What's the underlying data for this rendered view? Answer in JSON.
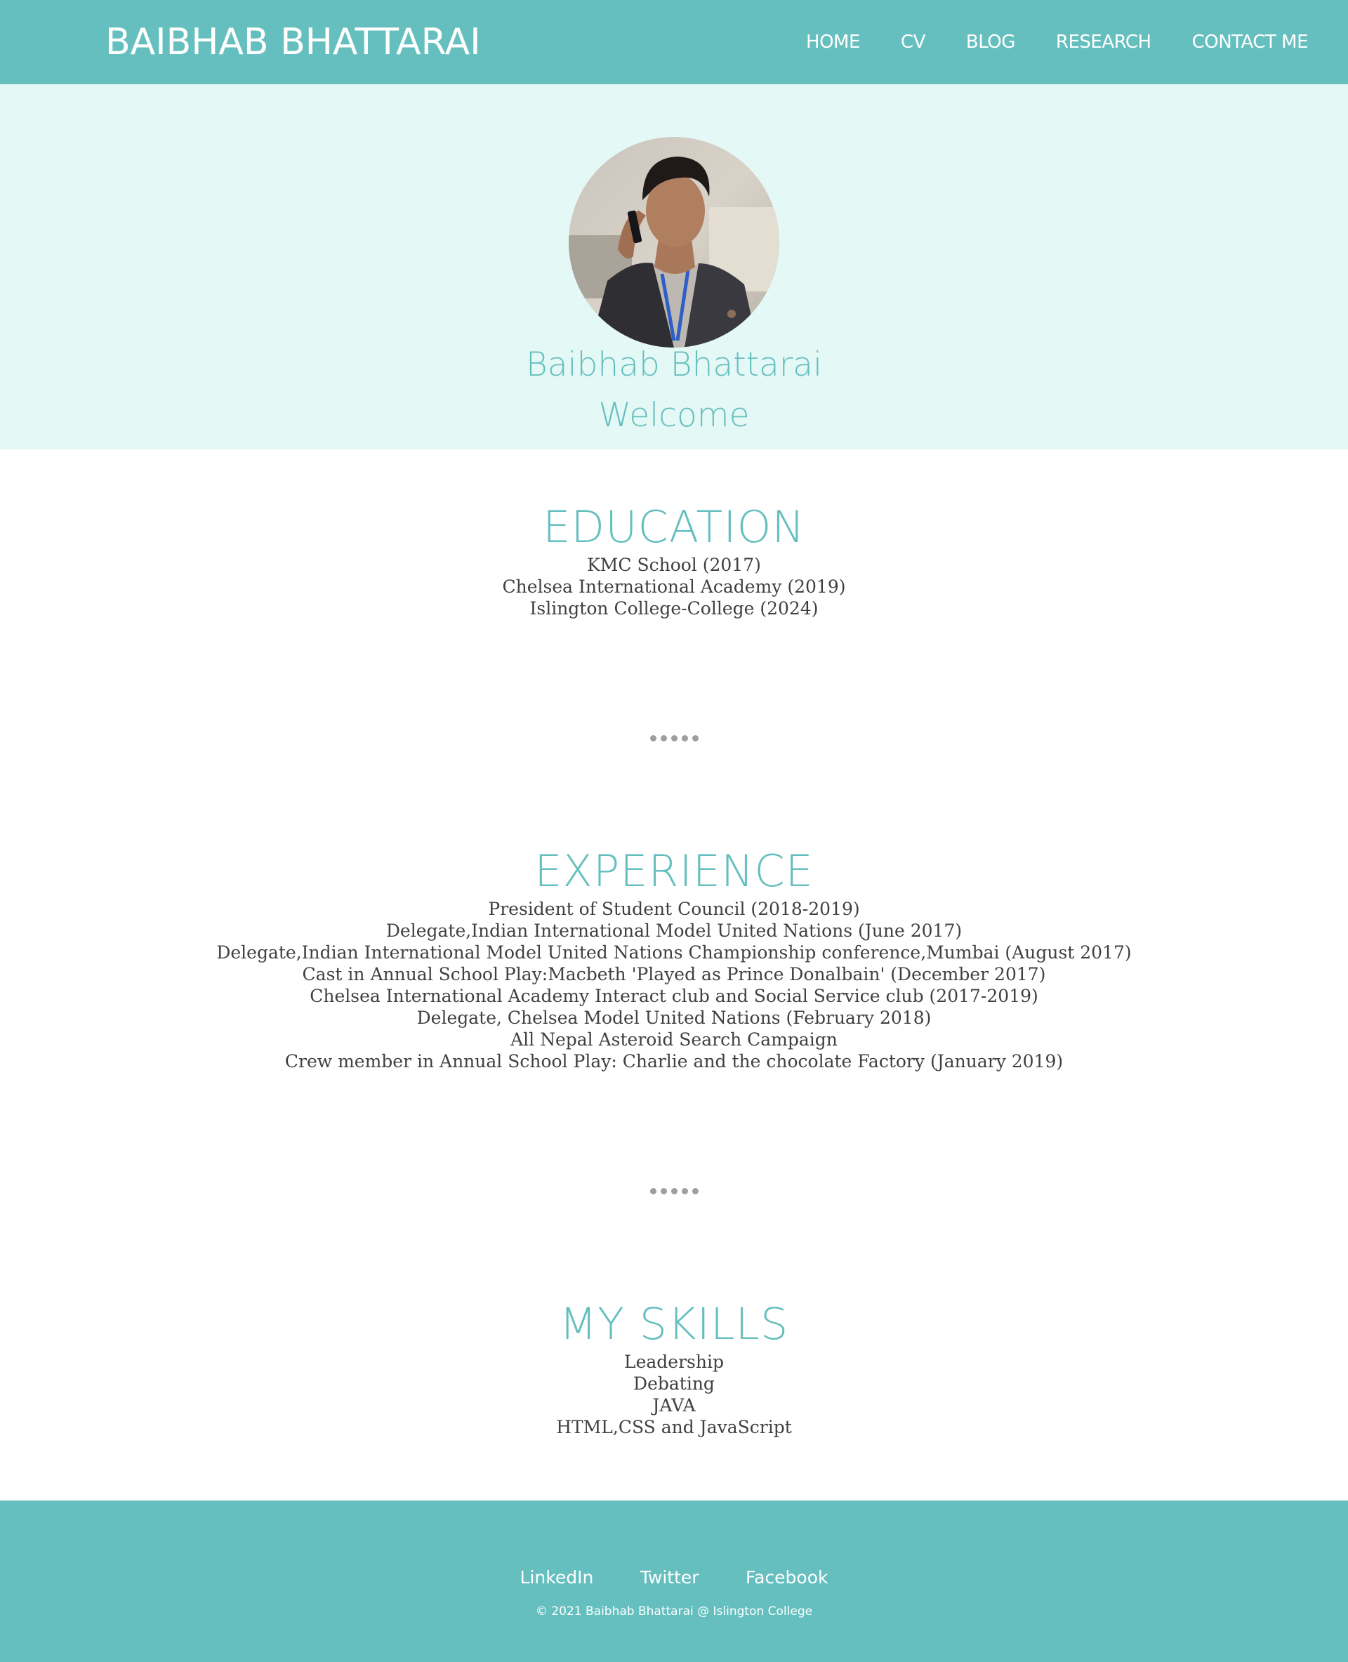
{
  "header": {
    "brand": "BAIBHAB BHATTARAI",
    "nav": [
      {
        "label": "HOME"
      },
      {
        "label": "CV"
      },
      {
        "label": "BLOG"
      },
      {
        "label": "RESEARCH"
      },
      {
        "label": "CONTACT ME"
      }
    ]
  },
  "hero": {
    "name": "Baibhab Bhattarai",
    "welcome": "Welcome"
  },
  "education": {
    "title": "EDUCATION",
    "items": [
      "KMC School (2017)",
      "Chelsea International Academy (2019)",
      "Islington College-College (2024)"
    ]
  },
  "experience": {
    "title": "EXPERIENCE",
    "items": [
      "President of Student Council (2018-2019)",
      "Delegate,Indian International Model United Nations (June 2017)",
      "Delegate,Indian International Model United Nations Championship conference,Mumbai (August 2017)",
      "Cast in Annual School Play:Macbeth 'Played as Prince Donalbain' (December 2017)",
      "Chelsea International Academy Interact club and Social Service club (2017-2019)",
      "Delegate, Chelsea Model United Nations (February 2018)",
      "All Nepal Asteroid Search Campaign",
      "Crew member in Annual School Play: Charlie and the chocolate Factory (January 2019)"
    ]
  },
  "skills": {
    "title": "MY SKILLS",
    "items": [
      "Leadership",
      "Debating",
      "JAVA",
      "HTML,CSS and JavaScript"
    ]
  },
  "footer": {
    "links": [
      {
        "label": "LinkedIn"
      },
      {
        "label": "Twitter"
      },
      {
        "label": "Facebook"
      }
    ],
    "copyright": "© 2021 Baibhab Bhattarai @ Islington College"
  },
  "colors": {
    "accent": "#66bfbf",
    "hero_bg": "#e4f9f5",
    "text": "#404040",
    "dots": "#9e9e9e"
  },
  "icons": {
    "avatar": "profile-photo"
  }
}
